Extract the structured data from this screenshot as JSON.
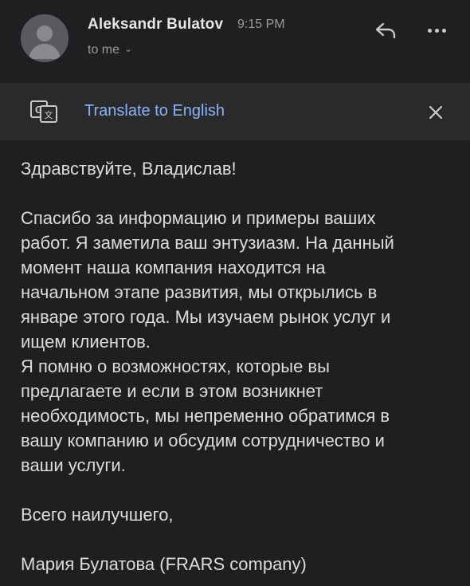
{
  "header": {
    "sender_name": "Aleksandr Bulatov",
    "time": "9:15 PM",
    "recipient_label": "to me",
    "reply_icon": "reply-icon",
    "more_icon": "more-dots-icon"
  },
  "translate_bar": {
    "icon": "google-translate-icon",
    "link_label": "Translate to English",
    "close_icon": "close-icon"
  },
  "message": {
    "greeting": "Здравствуйте, Владислав!",
    "paragraph1_lines": [
      "Спасибо за информацию и примеры ваших",
      "работ. Я заметила ваш энтузиазм. На данный",
      "момент наша компания находится на",
      "начальном этапе развития, мы открылись в",
      "январе этого года. Мы изучаем рынок услуг и",
      "ищем клиентов.",
      "Я помню о возможностях, которые вы",
      "предлагаете и если в этом возникнет",
      "необходимость, мы непременно обратимся в",
      "вашу компанию и обсудим сотрудничество и",
      "ваши услуги."
    ],
    "closing": "Всего наилучшего,",
    "signature": "Мария Булатова (FRARS company)"
  },
  "colors": {
    "background": "#1f1f21",
    "translate_bar": "#2a2a2d",
    "link": "#8ab4f8",
    "secondary_text": "#9a9a9a"
  }
}
